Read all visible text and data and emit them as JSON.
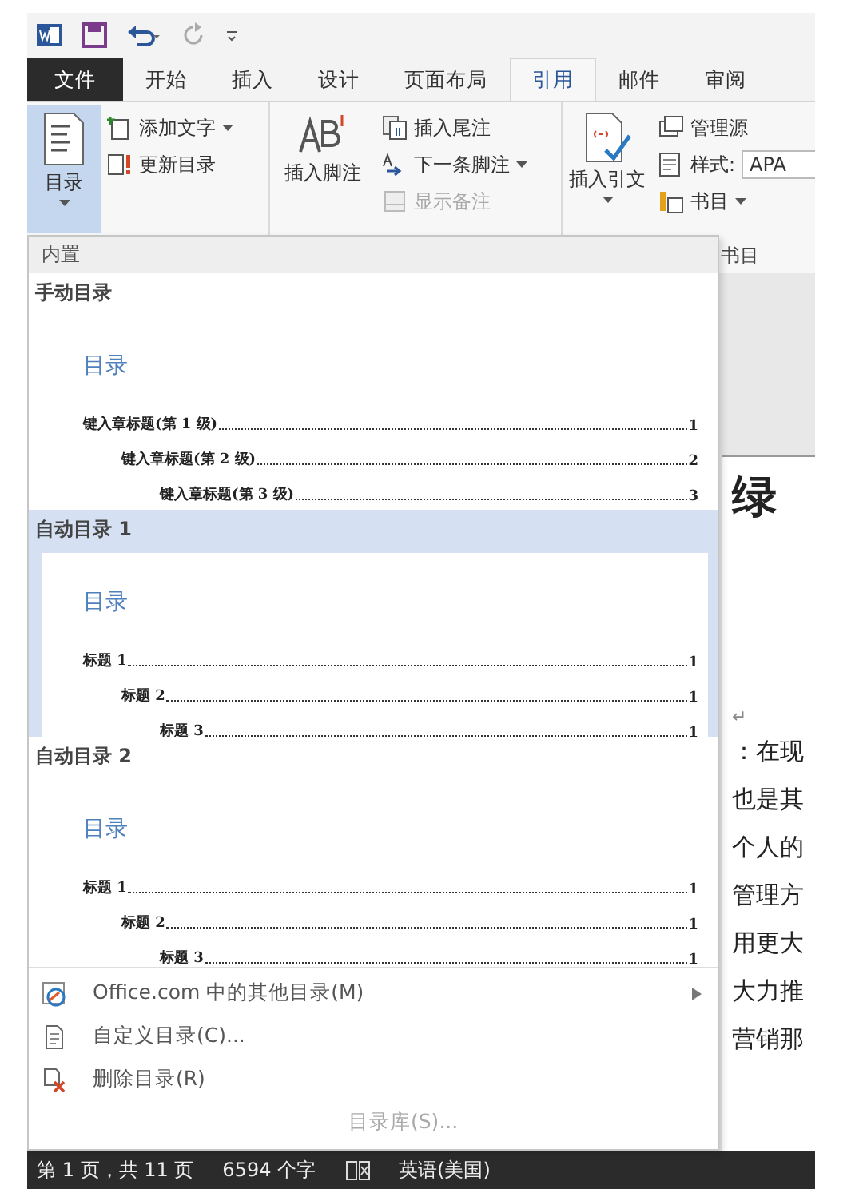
{
  "tabs": [
    {
      "label": "文件",
      "kind": "file",
      "selected": false
    },
    {
      "label": "开始",
      "kind": "tab",
      "selected": false
    },
    {
      "label": "插入",
      "kind": "tab",
      "selected": false
    },
    {
      "label": "设计",
      "kind": "tab",
      "selected": false
    },
    {
      "label": "页面布局",
      "kind": "tab",
      "selected": false
    },
    {
      "label": "引用",
      "kind": "tab",
      "selected": true
    },
    {
      "label": "邮件",
      "kind": "tab",
      "selected": false
    },
    {
      "label": "审阅",
      "kind": "tab",
      "selected": false
    }
  ],
  "ribbon": {
    "toc_button": {
      "label": "目录",
      "pressed": true
    },
    "toc_small": [
      {
        "label": "添加文字",
        "menu": true
      },
      {
        "label": "更新目录",
        "menu": false
      }
    ],
    "footnote_button": {
      "label": "插入脚注"
    },
    "footnote_small": [
      {
        "label": "插入尾注",
        "menu": false,
        "disabled": false
      },
      {
        "label": "下一条脚注",
        "menu": true,
        "disabled": false
      },
      {
        "label": "显示备注",
        "menu": false,
        "disabled": true
      }
    ],
    "citation_button": {
      "label": "插入引文"
    },
    "manage_sources": "管理源",
    "style_field": {
      "label": "样式:",
      "value": "APA"
    },
    "bibliography": "书目",
    "group_label": "书目"
  },
  "menu": {
    "header": "内置",
    "gallery": [
      {
        "title": "手动目录",
        "selected": false,
        "toc_title": "目录",
        "entries": [
          {
            "text": "键入章标题(第 1 级)",
            "page": "1",
            "children": [
              {
                "text": "键入章标题(第 2 级)",
                "page": "2",
                "children": [
                  {
                    "text": "键入章标题(第 3 级)",
                    "page": "3"
                  }
                ]
              }
            ]
          }
        ]
      },
      {
        "title": "自动目录 1",
        "selected": true,
        "toc_title": "目录",
        "entries": [
          {
            "text": "标题 1",
            "page": "1",
            "children": [
              {
                "text": "标题 2",
                "page": "1",
                "children": [
                  {
                    "text": "标题 3",
                    "page": "1"
                  }
                ]
              }
            ]
          }
        ]
      },
      {
        "title": "自动目录 2",
        "selected": false,
        "toc_title": "目录",
        "entries": [
          {
            "text": "标题 1",
            "page": "1",
            "children": [
              {
                "text": "标题 2",
                "page": "1",
                "children": [
                  {
                    "text": "标题 3",
                    "page": "1"
                  }
                ]
              }
            ]
          }
        ]
      }
    ],
    "items": [
      {
        "label": "Office.com 中的其他目录(M)",
        "submenu": true,
        "disabled": false
      },
      {
        "label": "自定义目录(C)...",
        "submenu": false,
        "disabled": false
      },
      {
        "label": "删除目录(R)",
        "submenu": false,
        "disabled": false
      },
      {
        "label": "目录库(S)...",
        "submenu": false,
        "disabled": true
      }
    ]
  },
  "document": {
    "heading": "绿",
    "paragraph_mark": "↵",
    "lines": [
      "：在现",
      "也是其",
      "个人的",
      "管理方",
      "用更大",
      "大力推",
      "营销那"
    ]
  },
  "status_bar": {
    "page": "第 1 页，共 11 页",
    "words": "6594 个字",
    "language": "英语(美国)"
  }
}
